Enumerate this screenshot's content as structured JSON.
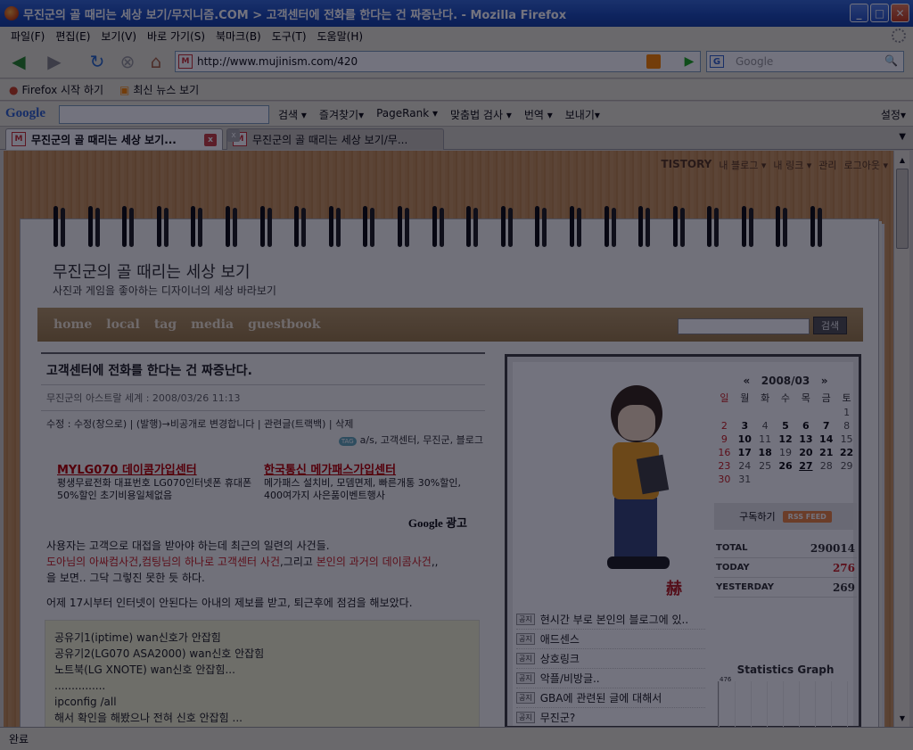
{
  "window": {
    "title": "무진군의 골 때리는 세상 보기/무지니즘.COM > 고객센터에 전화를 한다는 건 짜증난다. - Mozilla Firefox"
  },
  "menu": [
    "파일(F)",
    "편집(E)",
    "보기(V)",
    "바로 가기(S)",
    "북마크(B)",
    "도구(T)",
    "도움말(H)"
  ],
  "nav": {
    "url": "http://www.mujinism.com/420",
    "search_placeholder": "Google",
    "favicon": "M"
  },
  "bookmarks": [
    {
      "label": "Firefox 시작 하기"
    },
    {
      "label": "최신 뉴스 보기"
    }
  ],
  "google_toolbar": {
    "logo": "Google",
    "tools": [
      "검색 ▾",
      "즐겨찾기▾",
      "PageRank ▾",
      "맞춤법 검사 ▾",
      "번역 ▾",
      "보내기▾"
    ],
    "settings": "설정▾"
  },
  "tabs": [
    {
      "label": "무진군의 골 때리는 세상 보기...",
      "close": "x"
    },
    {
      "label": "무진군의 골 때리는 세상 보기/무...",
      "close": "x"
    }
  ],
  "tistory": {
    "logo": "TISTORY",
    "links": [
      "내 블로그 ▾",
      "내 링크 ▾",
      "관리",
      "로그아웃 ▾"
    ]
  },
  "blog": {
    "title": "무진군의 골 때리는 세상 보기",
    "subtitle": "사진과 게임을 좋아하는 디자이너의 세상 바라보기",
    "nav": [
      "home",
      "local",
      "tag",
      "media",
      "guestbook"
    ],
    "search_button": "검색"
  },
  "post": {
    "title": "고객센터에 전화를 한다는 건 짜증난다.",
    "category": "무진군의 아스트랄 세계",
    "date": "2008/03/26 11:13",
    "actions": "수정 : 수정(창으로) | (발행)→비공개로 변경합니다 | 관련글(트랙백) | 삭제",
    "tag_badge": "TAG",
    "tags": "a/s, 고객센터, 무진군, 블로그",
    "ads": [
      {
        "title": "MYLG070 데이콤가입센터",
        "body": "평생무료전화 대표번호 LG070인터넷폰 휴대폰50%할인 초기비용일체없음"
      },
      {
        "title": "한국통신 메가패스가입센터",
        "body": "메가패스 설치비, 모뎀면제, 빠른개통 30%할인, 400여가지 사은품이벤트행사"
      }
    ],
    "google_ads_label": "Google 광고",
    "para1_line1": "사용자는 고객으로 대접을 받아야 하는데 최근의 일련의 사건들.",
    "para1_red1": "도아님의 아싸컴사건",
    "para1_sep1": ",",
    "para1_red2": "컴팅님의 하나로 고객센터 사건",
    "para1_mid": ",그리고 ",
    "para1_red3": "본인의 과거의 데이콤사건",
    "para1_end": ",,",
    "para1_line3": "을 보면.. 그닥 그렇진 못한 듯 하다.",
    "para2": "어제 17시부터 인터넷이 안된다는 아내의 제보를 받고, 퇴근후에 점검을 해보았다.",
    "code_lines": [
      "공유기1(iptime) wan신호가 안잡힘",
      "공유기2(LG070 ASA2000) wan신호 안잡힘",
      "노트북(LG XNOTE) wan신호 안잡힘...",
      "...............",
      "ipconfig /all",
      "해서 확인을 해봤으나 전혀 신호 안잡힘 ..."
    ]
  },
  "sidebar": {
    "calendar": {
      "prev": "«",
      "next": "»",
      "month": "2008/03",
      "weekdays": [
        "일",
        "월",
        "화",
        "수",
        "목",
        "금",
        "토"
      ],
      "days": [
        "",
        "",
        "",
        "",
        "",
        "",
        "1",
        "2",
        "3",
        "4",
        "5",
        "6",
        "7",
        "8",
        "9",
        "10",
        "11",
        "12",
        "13",
        "14",
        "15",
        "16",
        "17",
        "18",
        "19",
        "20",
        "21",
        "22",
        "23",
        "24",
        "25",
        "26",
        "27",
        "28",
        "29",
        "30",
        "31"
      ]
    },
    "subscribe_label": "구독하기",
    "rss_label": "RSS FEED",
    "stats": [
      {
        "label": "TOTAL",
        "value": "290014"
      },
      {
        "label": "TODAY",
        "value": "276"
      },
      {
        "label": "YESTERDAY",
        "value": "269"
      }
    ],
    "notice_badge": "공지",
    "notices": [
      "현시간 부로 본인의 블로그에 있..",
      "애드센스",
      "상호링크",
      "악플/비방글..",
      "GBA에 관련된 글에 대해서",
      "무진군?"
    ],
    "stat_graph_title": "Statistics Graph",
    "stat_graph_peak": "476",
    "signature": "赫"
  },
  "status": {
    "text": "완료"
  }
}
